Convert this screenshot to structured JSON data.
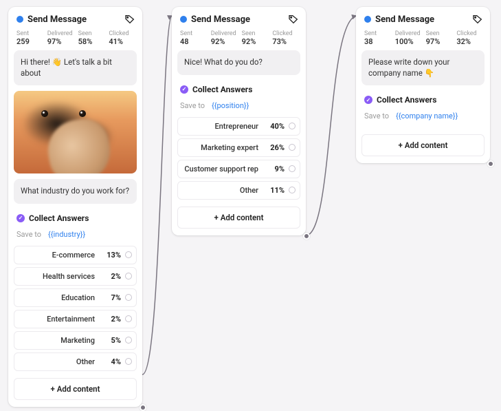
{
  "common": {
    "title": "Send Message",
    "stat_labels": {
      "sent": "Sent",
      "delivered": "Delivered",
      "seen": "Seen",
      "clicked": "Clicked"
    },
    "collect_label": "Collect Answers",
    "save_label": "Save to",
    "add_label": "+ Add content"
  },
  "card1": {
    "stats": {
      "sent": "259",
      "delivered": "97%",
      "seen": "58%",
      "clicked": "41%"
    },
    "message1": "Hi there! 👋 Let's talk a bit about",
    "message2": "What industry do you work for?",
    "save_var": "{{industry}}",
    "answers": [
      {
        "label": "E-commerce",
        "pct": "13%"
      },
      {
        "label": "Health services",
        "pct": "2%"
      },
      {
        "label": "Education",
        "pct": "7%"
      },
      {
        "label": "Entertainment",
        "pct": "2%"
      },
      {
        "label": "Marketing",
        "pct": "5%"
      },
      {
        "label": "Other",
        "pct": "4%"
      }
    ]
  },
  "card2": {
    "stats": {
      "sent": "48",
      "delivered": "92%",
      "seen": "92%",
      "clicked": "73%"
    },
    "message1": "Nice! What do you do?",
    "save_var": "{{position}}",
    "answers": [
      {
        "label": "Entrepreneur",
        "pct": "40%"
      },
      {
        "label": "Marketing expert",
        "pct": "26%"
      },
      {
        "label": "Customer support rep",
        "pct": "9%"
      },
      {
        "label": "Other",
        "pct": "11%"
      }
    ]
  },
  "card3": {
    "stats": {
      "sent": "38",
      "delivered": "100%",
      "seen": "97%",
      "clicked": "32%"
    },
    "message1": "Please write down your company name 👇",
    "save_var": "{{company name}}"
  }
}
